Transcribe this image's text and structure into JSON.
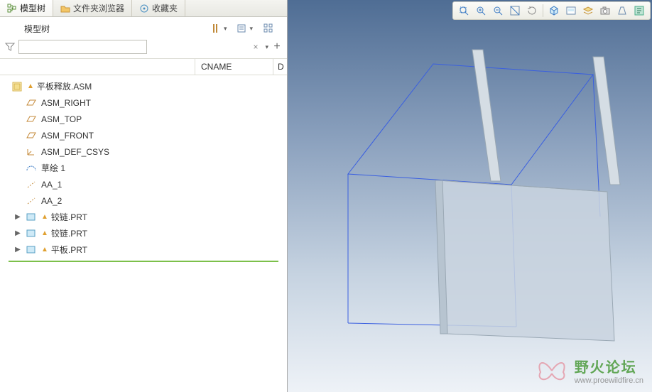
{
  "tabs": [
    {
      "label": "模型树",
      "icon": "tree-icon",
      "active": true
    },
    {
      "label": "文件夹浏览器",
      "icon": "folder-icon",
      "active": false
    },
    {
      "label": "收藏夹",
      "icon": "favorites-icon",
      "active": false
    }
  ],
  "panel": {
    "title": "模型树",
    "filter_placeholder": "",
    "filter_value": ""
  },
  "columns": {
    "col2": "CNAME",
    "col3": "D"
  },
  "tree": {
    "root": {
      "label": "平板释放.ASM",
      "icon": "assembly-icon",
      "warn": true
    },
    "children": [
      {
        "label": "ASM_RIGHT",
        "icon": "datum-plane-icon",
        "expandable": false
      },
      {
        "label": "ASM_TOP",
        "icon": "datum-plane-icon",
        "expandable": false
      },
      {
        "label": "ASM_FRONT",
        "icon": "datum-plane-icon",
        "expandable": false
      },
      {
        "label": "ASM_DEF_CSYS",
        "icon": "csys-icon",
        "expandable": false
      },
      {
        "label": "草绘 1",
        "icon": "sketch-icon",
        "expandable": false
      },
      {
        "label": "AA_1",
        "icon": "axis-icon",
        "expandable": false
      },
      {
        "label": "AA_2",
        "icon": "axis-icon",
        "expandable": false
      },
      {
        "label": "铰链.PRT",
        "icon": "part-icon",
        "warn": true,
        "expandable": true
      },
      {
        "label": "铰链.PRT",
        "icon": "part-icon",
        "warn": true,
        "expandable": true
      },
      {
        "label": "平板.PRT",
        "icon": "part-icon",
        "warn": true,
        "expandable": true
      }
    ]
  },
  "watermark": {
    "title": "野火论坛",
    "url": "www.proewildfire.cn"
  },
  "view_tools": [
    "zoom-window-icon",
    "zoom-in-icon",
    "zoom-out-icon",
    "refit-icon",
    "spin-icon",
    "sep",
    "display-style-icon",
    "saved-views-icon",
    "layers-icon",
    "snapshot-icon",
    "perspective-icon",
    "annotations-icon"
  ]
}
